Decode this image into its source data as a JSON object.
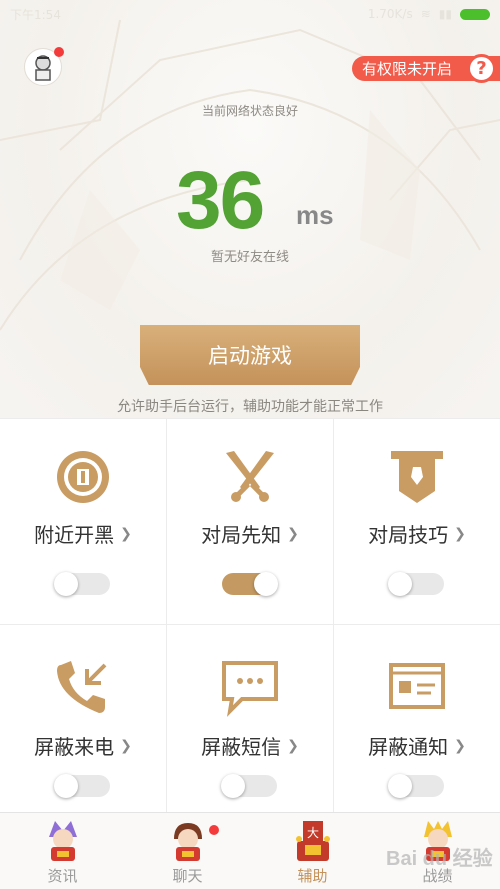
{
  "status_bar": {
    "time": "下午1:54",
    "speed": "1.70K/s"
  },
  "header": {
    "permission_badge": "有权限未开启",
    "help_icon": "?"
  },
  "network": {
    "status": "当前网络状态良好",
    "ping": "36",
    "unit": "ms",
    "friends": "暂无好友在线"
  },
  "start_button": "启动游戏",
  "hint": "允许助手后台运行，辅助功能才能正常工作",
  "features": [
    {
      "label": "附近开黑",
      "icon": "radar-icon",
      "enabled": false
    },
    {
      "label": "对局先知",
      "icon": "crossed-swords-icon",
      "enabled": true
    },
    {
      "label": "对局技巧",
      "icon": "banner-icon",
      "enabled": false
    },
    {
      "label": "屏蔽来电",
      "icon": "phone-call-icon",
      "enabled": false
    },
    {
      "label": "屏蔽短信",
      "icon": "message-icon",
      "enabled": false
    },
    {
      "label": "屏蔽通知",
      "icon": "notification-card-icon",
      "enabled": false
    }
  ],
  "nav": [
    {
      "label": "资讯",
      "active": false
    },
    {
      "label": "聊天",
      "active": false,
      "badge": true
    },
    {
      "label": "辅助",
      "active": true
    },
    {
      "label": "战绩",
      "active": false
    }
  ],
  "watermark": "Bai du 经验",
  "colors": {
    "accent_gold": "#c4925a",
    "ping_green": "#52a234",
    "badge_red": "#f25a4a"
  }
}
